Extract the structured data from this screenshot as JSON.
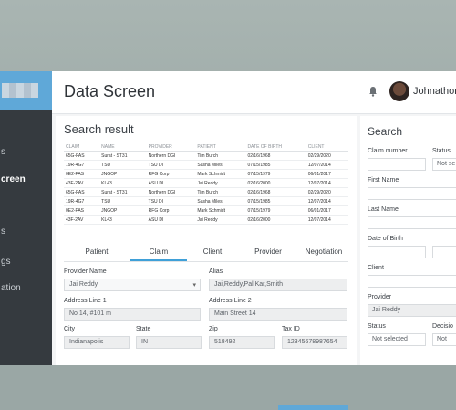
{
  "header": {
    "title": "Data Screen",
    "username": "Johnathon"
  },
  "sidebar": {
    "items": [
      "s",
      "creen",
      "s",
      "gs",
      "ation"
    ]
  },
  "results": {
    "title": "Search result",
    "columns": [
      "CLAIM",
      "NAME",
      "PROVIDER",
      "PATIENT",
      "DATE OF BIRTH",
      "CLIENT"
    ],
    "rows": [
      [
        "65G-FAS",
        "Surat - ST31",
        "Northern DGI",
        "Tim Burch",
        "02/16/1968",
        "02/29/2020"
      ],
      [
        "19R-4G7",
        "TSU",
        "TSU DI",
        "Sasha Miles",
        "07/15/1985",
        "12/07/2014"
      ],
      [
        "0E2-FAS",
        "JNGOP",
        "RFG Corp",
        "Mark Schmidt",
        "07/15/1979",
        "06/01/2017"
      ],
      [
        "43F-2AV",
        "KL43",
        "ASU DI",
        "Jai Reddy",
        "02/16/2000",
        "12/07/2014"
      ],
      [
        "65G-FAS",
        "Surat - ST31",
        "Northern DGI",
        "Tim Burch",
        "02/16/1968",
        "02/29/2020"
      ],
      [
        "19R-4G7",
        "TSU",
        "TSU DI",
        "Sasha Miles",
        "07/15/1985",
        "12/07/2014"
      ],
      [
        "0E2-FAS",
        "JNGOP",
        "RFG Corp",
        "Mark Schmidt",
        "07/15/1979",
        "06/01/2017"
      ],
      [
        "43F-2AV",
        "KL43",
        "ASU DI",
        "Jai Reddy",
        "02/16/2000",
        "12/07/2014"
      ]
    ]
  },
  "tabs": [
    "Patient",
    "Claim",
    "Client",
    "Provider",
    "Negotiation"
  ],
  "form": {
    "provider_name_label": "Provider Name",
    "provider_name": "Jai Reddy",
    "alias_label": "Alias",
    "alias": "Jai,Reddy,Pal,Kar,Smith",
    "address1_label": "Address Line 1",
    "address1": "No 14, #101 m",
    "address2_label": "Address Line 2",
    "address2": "Main Street 14",
    "city_label": "City",
    "city": "Indianapolis",
    "state_label": "State",
    "state": "IN",
    "zip_label": "Zip",
    "zip": "518492",
    "taxid_label": "Tax ID",
    "taxid": "12345678987654"
  },
  "search": {
    "title": "Search",
    "claim_label": "Claim number",
    "status_top_label": "Status",
    "status_top_value": "Not se",
    "first_label": "First Name",
    "last_label": "Last Name",
    "dob_label": "Date of Birth",
    "client_label": "Client",
    "provider_label": "Provider",
    "provider_value": "Jai Reddy",
    "status_label": "Status",
    "status_value": "Not selected",
    "decision_label": "Decisio",
    "decision_value": "Not"
  },
  "colors": {
    "accent": "#3fa0d8",
    "sidebar": "#353a3f"
  },
  "icons": [
    "bell-icon",
    "avatar"
  ]
}
